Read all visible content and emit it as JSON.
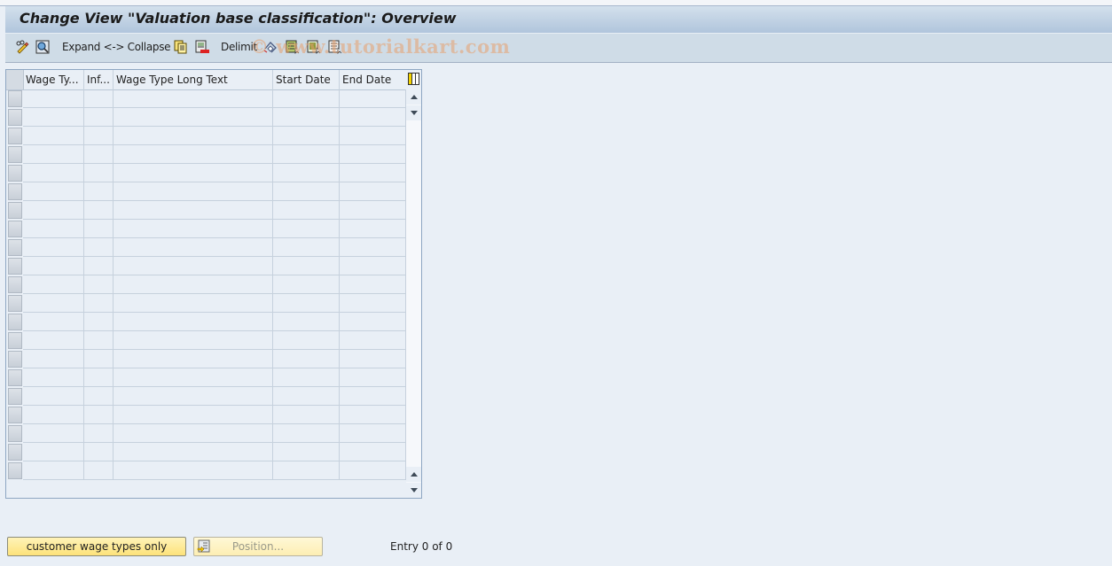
{
  "window": {
    "title": "Change View \"Valuation base classification\": Overview"
  },
  "toolbar": {
    "items": [
      {
        "icon": "edit-glasses-icon",
        "label": ""
      },
      {
        "icon": "find-icon",
        "label": ""
      },
      {
        "icon": "",
        "label": "Expand <-> Collapse"
      },
      {
        "icon": "copy-icon",
        "label": ""
      },
      {
        "icon": "delete-icon",
        "label": ""
      },
      {
        "icon": "",
        "label": "Delimit"
      },
      {
        "icon": "undo-change-icon",
        "label": ""
      },
      {
        "icon": "select-all-icon",
        "label": ""
      },
      {
        "icon": "select-block-icon",
        "label": ""
      },
      {
        "icon": "deselect-all-icon",
        "label": ""
      }
    ],
    "expand_label": "Expand <-> Collapse",
    "delimit_label": "Delimit"
  },
  "watermark": "© www.tutorialkart.com",
  "table": {
    "columns": [
      {
        "label": "Wage Ty..."
      },
      {
        "label": "Inf..."
      },
      {
        "label": "Wage Type Long Text"
      },
      {
        "label": "Start Date"
      },
      {
        "label": "End Date"
      }
    ],
    "row_count": 21,
    "rows": []
  },
  "footer": {
    "customer_button_label": "customer wage types only",
    "position_button_label": "Position...",
    "entry_text": "Entry 0 of 0"
  }
}
